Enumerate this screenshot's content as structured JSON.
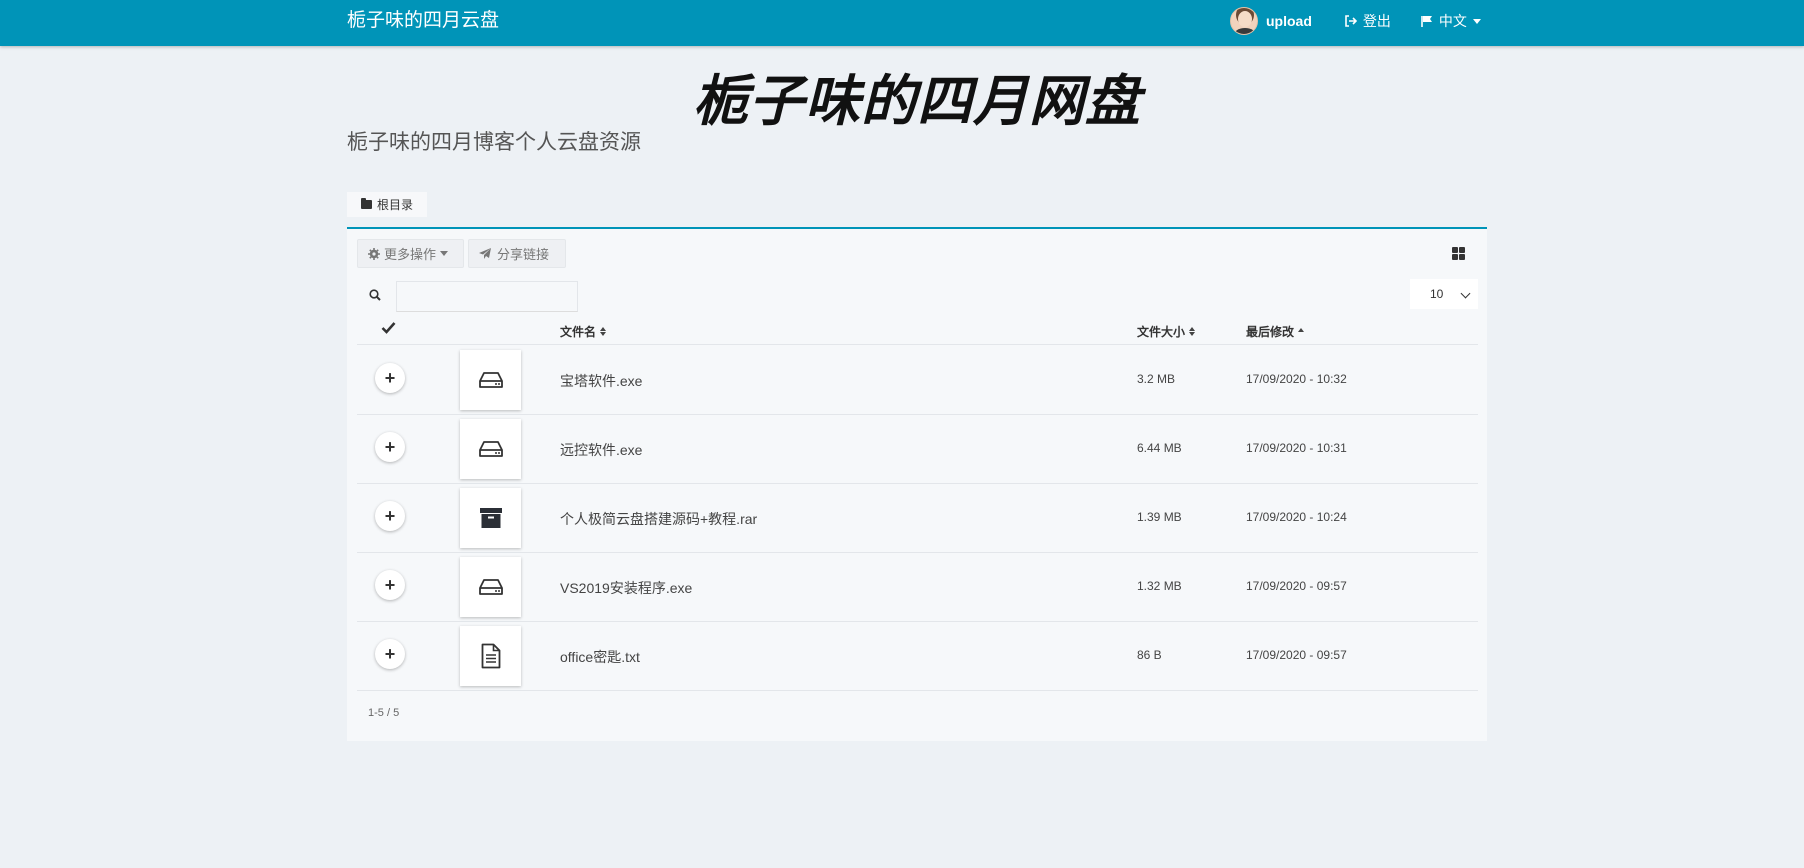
{
  "navbar": {
    "brand": "栀子味的四月云盘",
    "user": "upload",
    "logout": "登出",
    "language": "中文"
  },
  "header": {
    "title": "栀子味的四月网盘",
    "subtitle": "栀子味的四月博客个人云盘资源"
  },
  "breadcrumb": {
    "root": "根目录"
  },
  "toolbar": {
    "more_actions": "更多操作",
    "share_link": "分享链接"
  },
  "search": {
    "value": "",
    "placeholder": ""
  },
  "page_size": "10",
  "table": {
    "headers": {
      "name": "文件名",
      "size": "文件大小",
      "modified": "最后修改"
    },
    "sort": {
      "modified": "ascending"
    },
    "rows": [
      {
        "name": "宝塔软件.exe",
        "size": "3.2 MB",
        "modified": "17/09/2020 - 10:32",
        "icon": "drive-icon"
      },
      {
        "name": "远控软件.exe",
        "size": "6.44 MB",
        "modified": "17/09/2020 - 10:31",
        "icon": "drive-icon"
      },
      {
        "name": "个人极简云盘搭建源码+教程.rar",
        "size": "1.39 MB",
        "modified": "17/09/2020 - 10:24",
        "icon": "archive-icon"
      },
      {
        "name": "VS2019安装程序.exe",
        "size": "1.32 MB",
        "modified": "17/09/2020 - 09:57",
        "icon": "drive-icon"
      },
      {
        "name": "office密匙.txt",
        "size": "86 B",
        "modified": "17/09/2020 - 09:57",
        "icon": "text-file-icon"
      }
    ]
  },
  "pager": {
    "info": "1-5 / 5"
  },
  "colors": {
    "primary": "#0094b8",
    "background": "#edf1f5",
    "panel": "#f6f8fa"
  }
}
